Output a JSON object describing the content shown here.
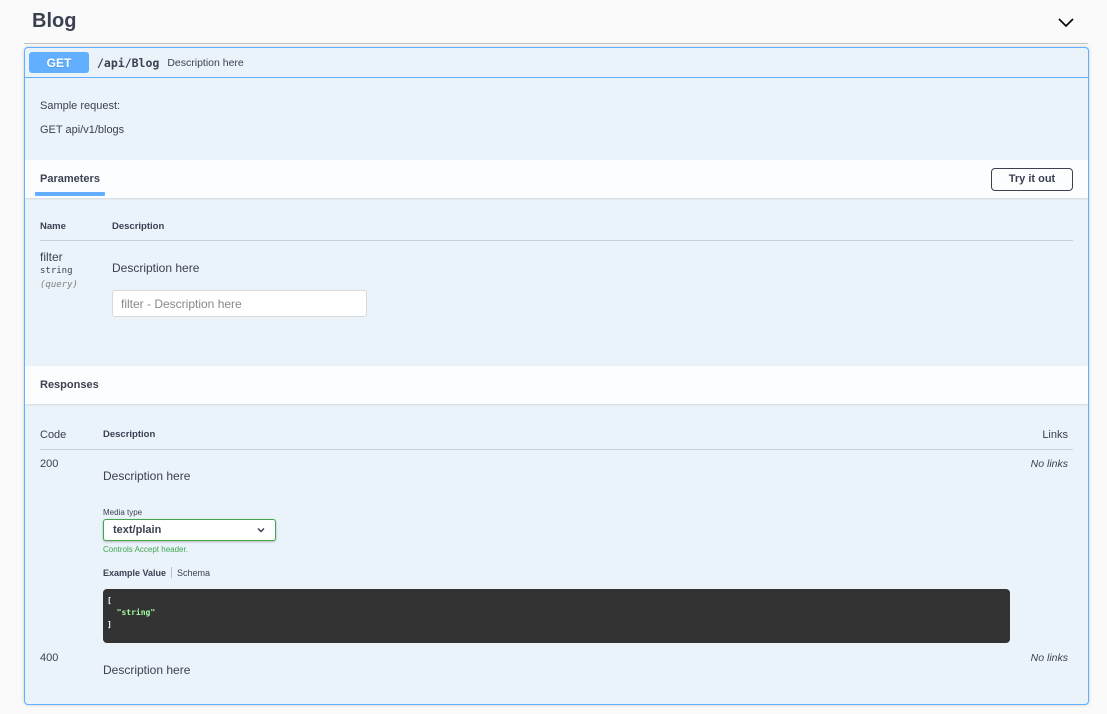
{
  "tag": {
    "title": "Blog",
    "toggle_icon": "chevron-down-icon"
  },
  "operation": {
    "method": "GET",
    "path": "/api/Blog",
    "summary": "Description here",
    "method_color": "#61affe"
  },
  "description": {
    "line1": "Sample request:",
    "line2": "GET api/v1/blogs"
  },
  "parameters": {
    "tab_label": "Parameters",
    "try_button": "Try it out",
    "columns": {
      "name": "Name",
      "description": "Description"
    },
    "items": [
      {
        "name": "filter",
        "type": "string",
        "in": "(query)",
        "description": "Description here",
        "placeholder": "filter - Description here"
      }
    ]
  },
  "responses": {
    "title": "Responses",
    "columns": {
      "code": "Code",
      "description": "Description",
      "links": "Links"
    },
    "items": [
      {
        "code": "200",
        "description": "Description here",
        "links": "No links",
        "media_type_label": "Media type",
        "media_type": "text/plain",
        "media_hint": "Controls Accept header.",
        "example_tab": "Example Value",
        "schema_tab": "Schema",
        "example_lines": [
          "[",
          "  \"string\"",
          "]"
        ]
      },
      {
        "code": "400",
        "description": "Description here",
        "links": "No links"
      }
    ]
  }
}
